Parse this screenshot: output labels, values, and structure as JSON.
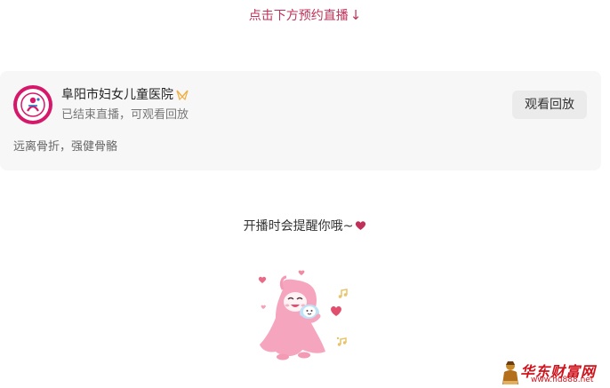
{
  "header": {
    "reserve_hint": "点击下方预约直播",
    "arrow_icon": "arrow-down-icon"
  },
  "live_card": {
    "hospital_name": "阜阳市妇女儿童医院",
    "verify_icon": "verified-badge-icon",
    "status_text": "已结束直播，可观看回放",
    "replay_button_label": "观看回放",
    "live_title": "远离骨折，强健骨骼"
  },
  "reminder": {
    "text": "开播时会提醒你哦~",
    "heart_icon": "heart-icon",
    "heart_color": "#c0315a"
  },
  "watermark": {
    "brand_text": "华东财富网",
    "url_text": "www.hd888.net"
  },
  "colors": {
    "accent": "#c0315a",
    "card_bg": "#f7f7f7",
    "button_bg": "#ebebeb",
    "avatar_brand": "#d6186b",
    "mascot_pink": "#f6a5be"
  }
}
